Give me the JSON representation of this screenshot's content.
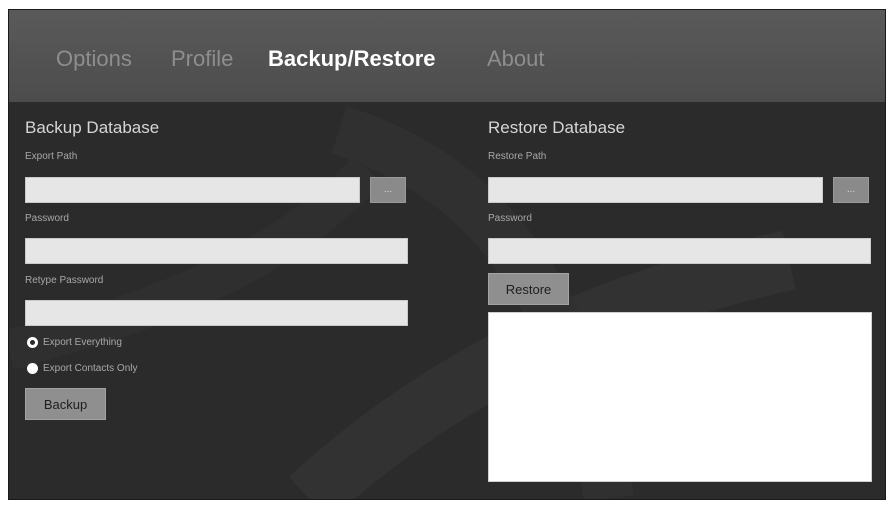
{
  "tabs": [
    {
      "label": "Options",
      "active": false
    },
    {
      "label": "Profile",
      "active": false
    },
    {
      "label": "Backup/Restore",
      "active": true
    },
    {
      "label": "About",
      "active": false
    }
  ],
  "backup": {
    "title": "Backup Database",
    "export_path_label": "Export Path",
    "export_path_value": "",
    "browse_label": "...",
    "password_label": "Password",
    "password_value": "",
    "retype_password_label": "Retype Password",
    "retype_password_value": "",
    "radio_options": [
      {
        "label": "Export Everything",
        "checked": true
      },
      {
        "label": "Export Contacts Only",
        "checked": false
      }
    ],
    "backup_button": "Backup"
  },
  "restore": {
    "title": "Restore Database",
    "restore_path_label": "Restore Path",
    "restore_path_value": "",
    "browse_label": "...",
    "password_label": "Password",
    "password_value": "",
    "restore_button": "Restore",
    "log_text": ""
  },
  "colors": {
    "window_bg": "#2b2b2b",
    "tabbar_bg": "#555555",
    "active_tab": "#ffffff",
    "inactive_tab": "#8e8e8e",
    "input_bg": "#e6e6e6",
    "button_bg": "#8f8f8f"
  }
}
